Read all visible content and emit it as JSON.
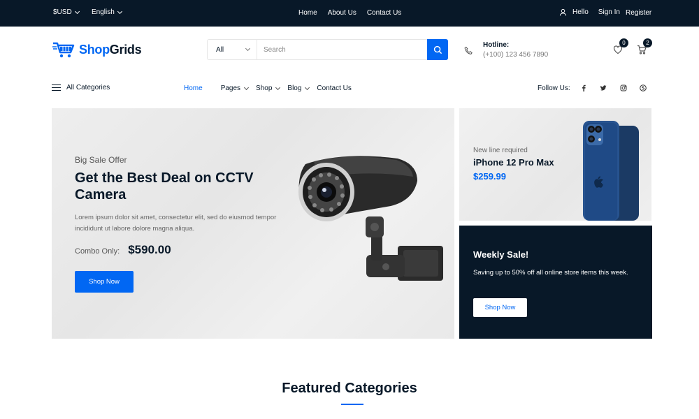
{
  "topbar": {
    "currency": "$USD",
    "language": "English",
    "nav": [
      "Home",
      "About Us",
      "Contact Us"
    ],
    "greeting": "Hello",
    "sign_in": "Sign In",
    "register": "Register"
  },
  "header": {
    "logo": {
      "part1": "Shop",
      "part2": "Grids"
    },
    "search": {
      "category": "All",
      "placeholder": "Search"
    },
    "hotline": {
      "label": "Hotline:",
      "number": "(+100) 123 456 7890"
    },
    "wishlist_count": "0",
    "cart_count": "2"
  },
  "nav": {
    "all_categories": "All Categories",
    "items": [
      {
        "label": "Home",
        "active": true
      },
      {
        "label": "Pages"
      },
      {
        "label": "Shop"
      },
      {
        "label": "Blog"
      },
      {
        "label": "Contact Us"
      }
    ],
    "follow_label": "Follow Us:",
    "social_icons": [
      "facebook-icon",
      "twitter-icon",
      "instagram-icon",
      "skype-icon"
    ]
  },
  "hero": {
    "subtitle": "Big Sale Offer",
    "title": "Get the Best Deal on CCTV Camera",
    "description": "Lorem ipsum dolor sit amet, consectetur elit, sed do eiusmod tempor incididunt ut labore dolore magna aliqua.",
    "price_label": "Combo Only:",
    "price": "$590.00",
    "button": "Shop Now"
  },
  "side_banner": {
    "subtitle": "New line required",
    "title": "iPhone 12 Pro Max",
    "price": "$259.99"
  },
  "weekly_sale": {
    "title": "Weekly Sale!",
    "description": "Saving up to 50% off all online store items this week.",
    "button": "Shop Now"
  },
  "featured": {
    "title": "Featured Categories"
  },
  "colors": {
    "primary": "#0167f3",
    "dark": "#081828",
    "hero_bg": "#eeeeee"
  }
}
